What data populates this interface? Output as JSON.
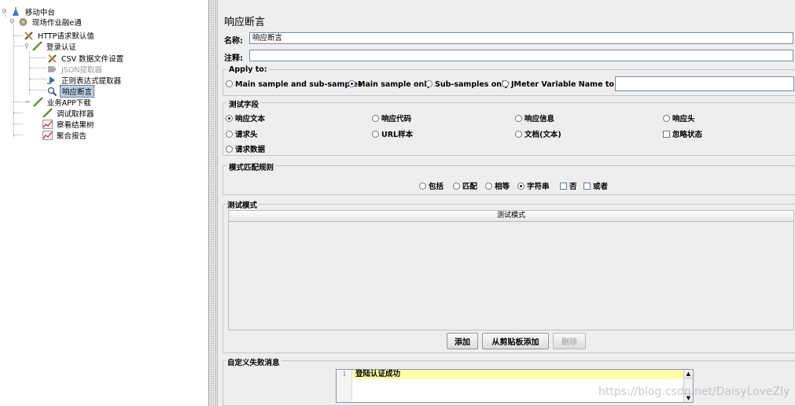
{
  "tree": {
    "items": [
      {
        "label": "移动中台",
        "icon": "testplan-icon",
        "toggle": "expanded"
      },
      {
        "label": "现场作业融e通",
        "icon": "threadgroup-gear-icon",
        "toggle": "expanded"
      },
      {
        "label": "HTTP请求默认值",
        "icon": "config-wrench-icon",
        "toggle": ""
      },
      {
        "label": "登录认证",
        "icon": "sampler-pencil-icon",
        "toggle": "expanded"
      },
      {
        "label": "CSV 数据文件设置",
        "icon": "config-wrench-icon",
        "toggle": ""
      },
      {
        "label": "JSON提取器",
        "icon": "extractor-disabled-icon",
        "toggle": ""
      },
      {
        "label": "正则表达式提取器",
        "icon": "extractor-arrow-icon",
        "toggle": ""
      },
      {
        "label": "响应断言",
        "icon": "assertion-magnifier-icon",
        "toggle": "",
        "selected": true
      },
      {
        "label": "业务APP下载",
        "icon": "sampler-pencil-icon",
        "toggle": "collapsed"
      },
      {
        "label": "调试取样器",
        "icon": "sampler-pencil-icon",
        "toggle": ""
      },
      {
        "label": "察看结果树",
        "icon": "listener-chart-icon",
        "toggle": ""
      },
      {
        "label": "聚合报告",
        "icon": "listener-chart-icon",
        "toggle": ""
      }
    ]
  },
  "panel": {
    "title": "响应断言",
    "name_label": "名称:",
    "name_value": "响应断言",
    "comment_label": "注释:",
    "comment_value": ""
  },
  "apply_to": {
    "label": "Apply to:",
    "options": [
      {
        "label": "Main sample and sub-samples",
        "checked": false
      },
      {
        "label": "Main sample only",
        "checked": true
      },
      {
        "label": "Sub-samples only",
        "checked": false
      },
      {
        "label": "JMeter Variable Name to use",
        "checked": false
      }
    ],
    "variable_value": ""
  },
  "test_field": {
    "label": "测试字段",
    "options": [
      {
        "label": "响应文本",
        "kind": "radio",
        "checked": true
      },
      {
        "label": "响应代码",
        "kind": "radio",
        "checked": false
      },
      {
        "label": "响应信息",
        "kind": "radio",
        "checked": false
      },
      {
        "label": "响应头",
        "kind": "radio",
        "checked": false
      },
      {
        "label": "请求头",
        "kind": "radio",
        "checked": false
      },
      {
        "label": "URL样本",
        "kind": "radio",
        "checked": false
      },
      {
        "label": "文档(文本)",
        "kind": "radio",
        "checked": false
      },
      {
        "label": "忽略状态",
        "kind": "checkbox",
        "checked": false
      },
      {
        "label": "请求数据",
        "kind": "radio",
        "checked": false
      }
    ]
  },
  "pattern_rules": {
    "label": "模式匹配规则",
    "options": [
      {
        "label": "包括",
        "kind": "radio",
        "checked": false
      },
      {
        "label": "匹配",
        "kind": "radio",
        "checked": false
      },
      {
        "label": "相等",
        "kind": "radio",
        "checked": false
      },
      {
        "label": "字符串",
        "kind": "radio",
        "checked": true
      },
      {
        "label": "否",
        "kind": "checkbox",
        "checked": false
      },
      {
        "label": "或者",
        "kind": "checkbox",
        "checked": false
      }
    ]
  },
  "test_patterns": {
    "label": "测试模式",
    "column_header": "测试模式",
    "rows": []
  },
  "buttons": {
    "add": "添加",
    "add_from_clipboard": "从剪贴板添加",
    "delete": "删除"
  },
  "failure_message": {
    "label": "自定义失败消息",
    "line_number": "1",
    "text": "登陆认证成功"
  },
  "watermark": "https://blog.csdn.net/DaisyLoveZly",
  "colors": {
    "background": "#eeeeee",
    "selection": "#b8cfe5",
    "editor_line_highlight": "#ffffaa"
  }
}
